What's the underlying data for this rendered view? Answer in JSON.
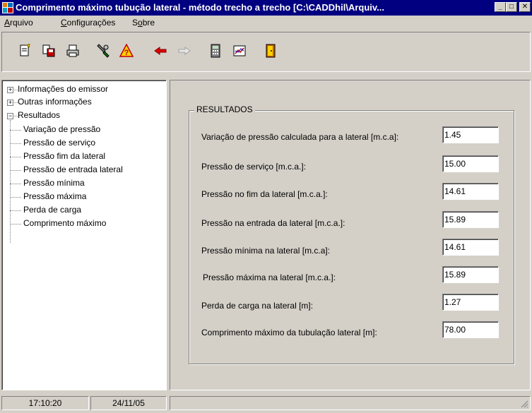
{
  "window": {
    "title": "Comprimento máximo tubução lateral - método trecho a trecho [C:\\CADDhil\\Arquiv...",
    "min_label": "_",
    "max_label": "□",
    "close_label": "✕"
  },
  "menu": [
    {
      "label": "Arquivo",
      "underline": "A",
      "rest": "rquivo"
    },
    {
      "label": "Configurações",
      "underline": "C",
      "rest": "onfigurações"
    },
    {
      "label": "Sobre",
      "underline_pre": "S",
      "underline": "o",
      "rest": "bre"
    }
  ],
  "toolbar": [
    {
      "icon": "new-file-icon"
    },
    {
      "icon": "save-file-icon"
    },
    {
      "icon": "print-icon"
    },
    {
      "icon": "tools-icon"
    },
    {
      "icon": "help-icon"
    },
    {
      "icon": "arrow-left-icon"
    },
    {
      "icon": "arrow-right-icon"
    },
    {
      "icon": "calculator-icon"
    },
    {
      "icon": "chart-icon"
    },
    {
      "icon": "exit-door-icon"
    }
  ],
  "tree": {
    "expand_symbol": "+",
    "collapse_symbol": "−",
    "root1": "Informações do emissor",
    "root2": "Outras informações",
    "root3": "Resultados",
    "children": [
      "Variação de pressão",
      "Pressão de serviço",
      "Pressão fim da lateral",
      "Pressão de entrada lateral",
      "Pressão mínima",
      "Pressão máxima",
      "Perda de carga",
      "Comprimento máximo"
    ]
  },
  "results": {
    "title": "RESULTADOS",
    "rows": [
      {
        "label": "Variação de pressão calculada para a lateral [m.c.a]:",
        "value": "1.45"
      },
      {
        "label": "Pressão de serviço [m.c.a.]:",
        "value": "15.00"
      },
      {
        "label": "Pressão no fim da lateral [m.c.a.]:",
        "value": "14.61"
      },
      {
        "label": "Pressão na entrada da lateral [m.c.a.]:",
        "value": "15.89"
      },
      {
        "label": "Pressão mínima na lateral [m.c.a]:",
        "value": "14.61"
      },
      {
        "label": "Pressão máxima na lateral [m.c.a.]:",
        "value": "15.89"
      },
      {
        "label": "Perda de carga na lateral [m]:",
        "value": "1.27"
      },
      {
        "label": "Comprimento máximo da tubulação lateral [m]:",
        "value": "78.00"
      }
    ]
  },
  "status": {
    "time": "17:10:20",
    "date": "24/11/05"
  }
}
